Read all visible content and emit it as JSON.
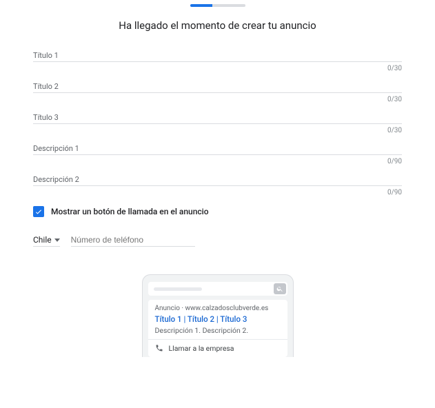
{
  "heading": "Ha llegado el momento de crear tu anuncio",
  "fields": {
    "title1": {
      "label": "Título 1",
      "counter": "0/30"
    },
    "title2": {
      "label": "Título 2",
      "counter": "0/30"
    },
    "title3": {
      "label": "Título 3",
      "counter": "0/30"
    },
    "desc1": {
      "label": "Descripción 1",
      "counter": "0/90"
    },
    "desc2": {
      "label": "Descripción 2",
      "counter": "0/90"
    }
  },
  "call": {
    "checkbox_label": "Mostrar un botón de llamada en el anuncio",
    "country": "Chile",
    "phone_placeholder": "Número de teléfono"
  },
  "preview": {
    "tag_prefix": "Anuncio",
    "separator": " · ",
    "domain": "www.calzadosclubverde.es",
    "titles": "Título 1 | Título 2 | Título 3",
    "descriptions": "Descripción 1. Descripción 2.",
    "call_label": "Llamar a la empresa"
  }
}
